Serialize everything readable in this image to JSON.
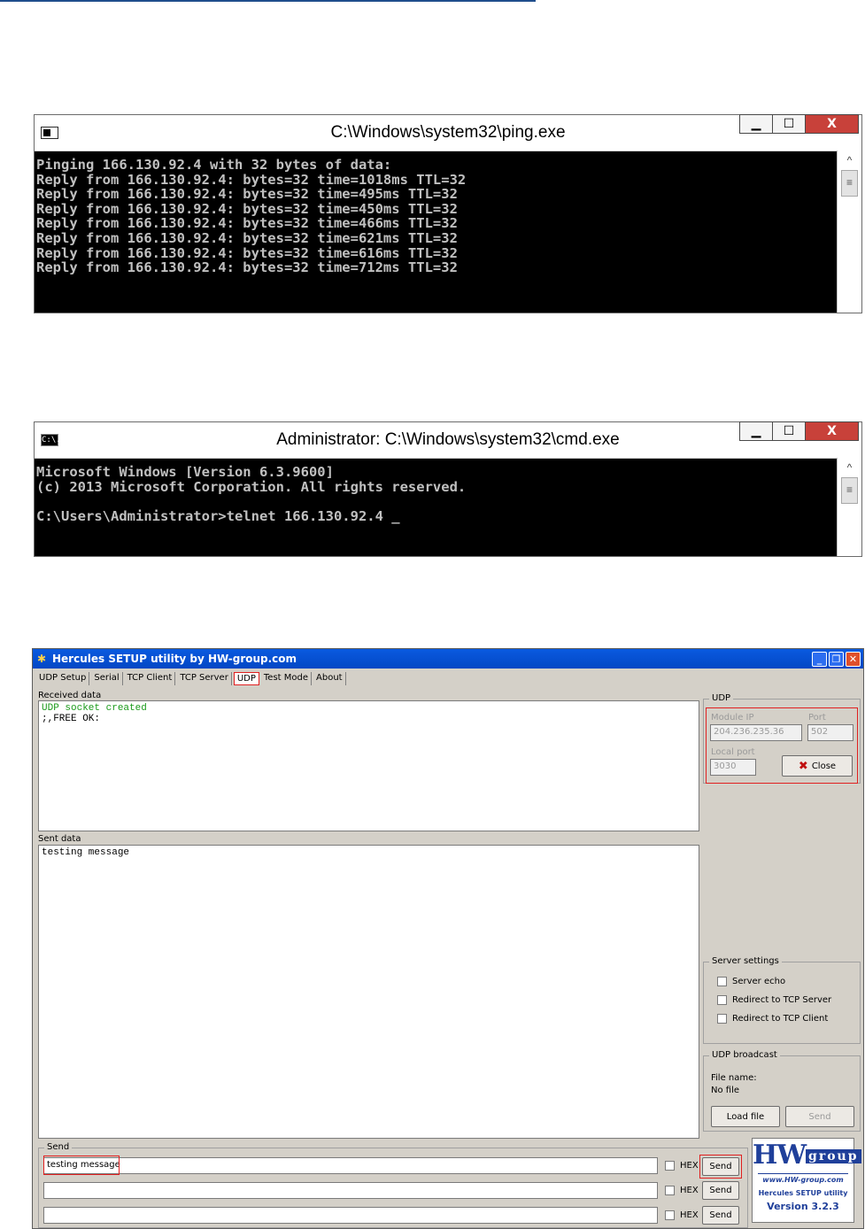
{
  "ping_window": {
    "title": "C:\\Windows\\system32\\ping.exe",
    "lines": [
      "Pinging 166.130.92.4 with 32 bytes of data:",
      "Reply from 166.130.92.4: bytes=32 time=1018ms TTL=32",
      "Reply from 166.130.92.4: bytes=32 time=495ms TTL=32",
      "Reply from 166.130.92.4: bytes=32 time=450ms TTL=32",
      "Reply from 166.130.92.4: bytes=32 time=466ms TTL=32",
      "Reply from 166.130.92.4: bytes=32 time=621ms TTL=32",
      "Reply from 166.130.92.4: bytes=32 time=616ms TTL=32",
      "Reply from 166.130.92.4: bytes=32 time=712ms TTL=32"
    ]
  },
  "cmd_window": {
    "title": "Administrator: C:\\Windows\\system32\\cmd.exe",
    "icon_text": "C:\\.",
    "lines": [
      "Microsoft Windows [Version 6.3.9600]",
      "(c) 2013 Microsoft Corporation. All rights reserved.",
      "",
      "C:\\Users\\Administrator>telnet 166.130.92.4 _"
    ]
  },
  "window_controls": {
    "minimize": "▁",
    "maximize": "☐",
    "close": "X"
  },
  "hercules": {
    "title": "Hercules SETUP utility by HW-group.com",
    "tabs": [
      "UDP Setup",
      "Serial",
      "TCP Client",
      "TCP Server",
      "UDP",
      "Test Mode",
      "About"
    ],
    "active_tab": "UDP",
    "received_label": "Received data",
    "received_lines": [
      "UDP socket created",
      ";,FREE OK:"
    ],
    "sent_label": "Sent data",
    "sent_text": "testing message",
    "udp": {
      "group_label": "UDP",
      "module_ip_label": "Module IP",
      "module_ip": "204.236.235.36",
      "port_label": "Port",
      "port": "502",
      "local_port_label": "Local port",
      "local_port": "3030",
      "close_label": "Close"
    },
    "server_settings": {
      "group_label": "Server settings",
      "options": [
        "Server echo",
        "Redirect to TCP Server",
        "Redirect to TCP Client"
      ]
    },
    "udp_broadcast": {
      "group_label": "UDP broadcast",
      "file_name_label": "File name:",
      "file_name_value": "No file",
      "load_label": "Load file",
      "send_label": "Send"
    },
    "send_group": {
      "label": "Send",
      "rows": [
        {
          "value": "testing message",
          "hex_label": "HEX",
          "send_label": "Send"
        },
        {
          "value": "",
          "hex_label": "HEX",
          "send_label": "Send"
        },
        {
          "value": "",
          "hex_label": "HEX",
          "send_label": "Send"
        }
      ]
    },
    "logo": {
      "url": "www.HW-group.com",
      "product": "Hercules SETUP utility",
      "version": "Version  3.2.3"
    },
    "accent_red": "#e02020"
  }
}
